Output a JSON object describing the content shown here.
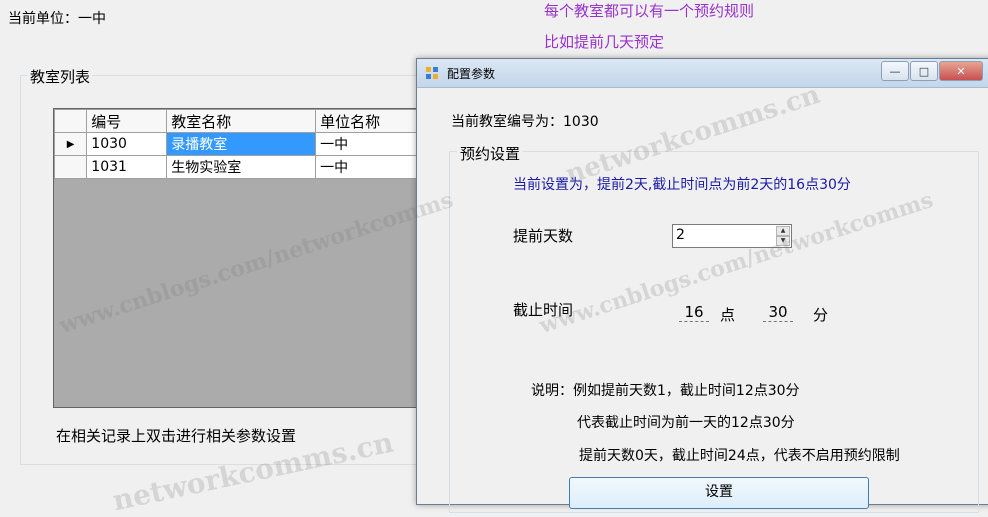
{
  "main": {
    "current_unit_label": "当前单位：一中",
    "group_title": "教室列表",
    "grid": {
      "columns": [
        "编号",
        "教室名称",
        "单位名称"
      ],
      "rows": [
        {
          "id": "1030",
          "name": "录播教室",
          "unit": "一中",
          "selected": true
        },
        {
          "id": "1031",
          "name": "生物实验室",
          "unit": "一中",
          "selected": false
        }
      ]
    },
    "hint": "在相关记录上双击进行相关参数设置"
  },
  "notes": [
    "每个教室都可以有一个预约规则",
    "比如提前几天预定"
  ],
  "dialog": {
    "title": "配置参数",
    "classroom_id_label": "当前教室编号为：1030",
    "group_title": "预约设置",
    "current_setting": "当前设置为，提前2天,截止时间点为前2天的16点30分",
    "advance_days_label": "提前天数",
    "advance_days_value": "2",
    "deadline_label": "截止时间",
    "hour_value": "16",
    "hour_unit": "点",
    "minute_value": "30",
    "minute_unit": "分",
    "explain": [
      "说明：例如提前天数1，截止时间12点30分",
      "代表截止时间为前一天的12点30分",
      "提前天数0天，截止时间24点，代表不启用预约限制"
    ],
    "set_button": "设置"
  },
  "watermarks": [
    "www.cnblogs.com/networkcomms",
    "networkcomms.cn"
  ],
  "colors": {
    "accent_selected": "#3399ff",
    "note_text": "#9933cc",
    "setting_text": "#1a1aa6"
  }
}
